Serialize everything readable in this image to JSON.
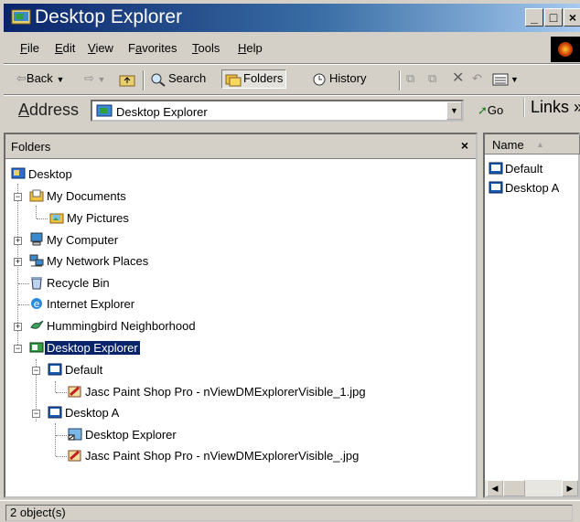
{
  "window": {
    "title": "Desktop Explorer"
  },
  "menu": [
    {
      "label": "File",
      "ul": "F",
      "rest": "ile"
    },
    {
      "label": "Edit",
      "ul": "E",
      "rest": "dit"
    },
    {
      "label": "View",
      "ul": "V",
      "rest": "iew"
    },
    {
      "label": "Favorites",
      "pre": "F",
      "ul": "a",
      "rest": "vorites"
    },
    {
      "label": "Tools",
      "ul": "T",
      "rest": "ools"
    },
    {
      "label": "Help",
      "ul": "H",
      "rest": "elp"
    }
  ],
  "toolbar": {
    "back": "Back",
    "search": "Search",
    "folders": "Folders",
    "history": "History"
  },
  "address": {
    "label": "Address",
    "value": "Desktop Explorer",
    "go": "Go",
    "links": "Links"
  },
  "folders_pane": {
    "title": "Folders",
    "close": "×",
    "tree": [
      "Desktop",
      "My Documents",
      "My Pictures",
      "My Computer",
      "My Network Places",
      "Recycle Bin",
      "Internet Explorer",
      "Hummingbird Neighborhood",
      "Desktop Explorer",
      "Default",
      "Jasc Paint Shop Pro - nViewDMExplorerVisible_1.jpg",
      "Desktop A",
      "Desktop Explorer",
      "Jasc Paint Shop Pro - nViewDMExplorerVisible_.jpg"
    ]
  },
  "list_pane": {
    "column": "Name",
    "items": [
      "Default",
      "Desktop A"
    ]
  },
  "status": {
    "text": "2 object(s)"
  },
  "colors": {
    "title_start": "#0a246a",
    "selection": "#0a246a",
    "chrome": "#d4d0c8"
  }
}
